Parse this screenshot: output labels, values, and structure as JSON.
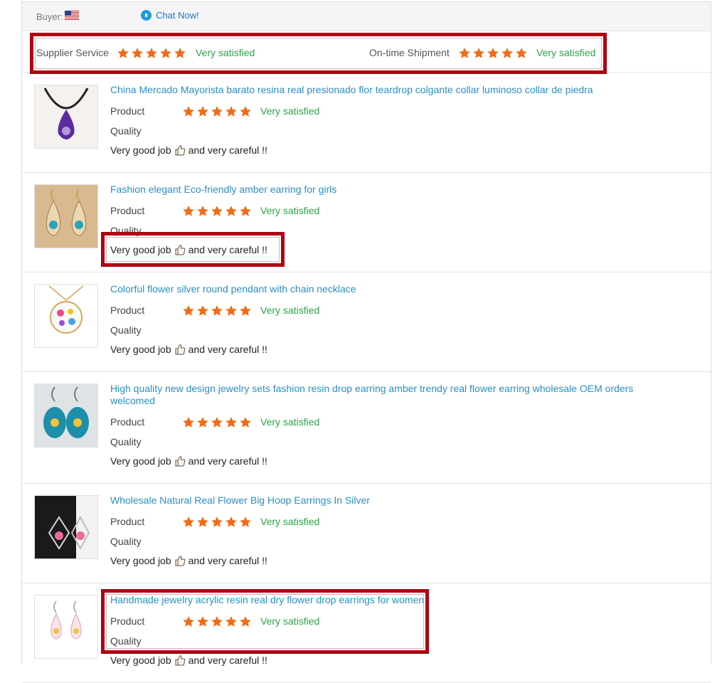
{
  "header": {
    "buyer_label": "Buyer:",
    "flag_icon": "us-flag-icon",
    "chat_label": "Chat Now!",
    "chat_icon": "chat-icon"
  },
  "service": {
    "supplier_label": "Supplier Service",
    "supplier_rating": 5,
    "supplier_status": "Very satisfied",
    "shipment_label": "On-time Shipment",
    "shipment_rating": 5,
    "shipment_status": "Very satisfied"
  },
  "colors": {
    "star": "#f26b16",
    "status_green": "#28a745",
    "link_blue": "#2a8fc8",
    "highlight_red": "#b00012"
  },
  "items": [
    {
      "title": "China Mercado Mayorista barato resina real presionado flor teardrop colgante collar luminoso collar de piedra",
      "product_label": "Product",
      "quality_label": "Quality",
      "rating": 5,
      "status": "Very satisfied",
      "comment_pre": "Very good job",
      "comment_post": "and very careful !!"
    },
    {
      "title": "Fashion elegant Eco-friendly amber earring for girls",
      "product_label": "Product",
      "quality_label": "Quality",
      "rating": 5,
      "status": "Very satisfied",
      "comment_pre": "Very good job",
      "comment_post": "and very careful !!"
    },
    {
      "title": "Colorful flower silver round pendant with chain necklace",
      "product_label": "Product",
      "quality_label": "Quality",
      "rating": 5,
      "status": "Very satisfied",
      "comment_pre": "Very good job",
      "comment_post": "and very careful !!"
    },
    {
      "title": "High quality new design jewelry sets fashion resin drop earring amber trendy real flower earring wholesale OEM orders welcomed",
      "product_label": "Product",
      "quality_label": "Quality",
      "rating": 5,
      "status": "Very satisfied",
      "comment_pre": "Very good job",
      "comment_post": "and very careful !!"
    },
    {
      "title": "Wholesale Natural Real Flower Big Hoop Earrings In Silver",
      "product_label": "Product",
      "quality_label": "Quality",
      "rating": 5,
      "status": "Very satisfied",
      "comment_pre": "Very good job",
      "comment_post": "and very careful !!"
    },
    {
      "title": "Handmade jewelry acrylic resin real dry flower drop earrings for women",
      "product_label": "Product",
      "quality_label": "Quality",
      "rating": 5,
      "status": "Very satisfied",
      "comment_pre": "Very good job",
      "comment_post": "and very careful !!"
    }
  ]
}
